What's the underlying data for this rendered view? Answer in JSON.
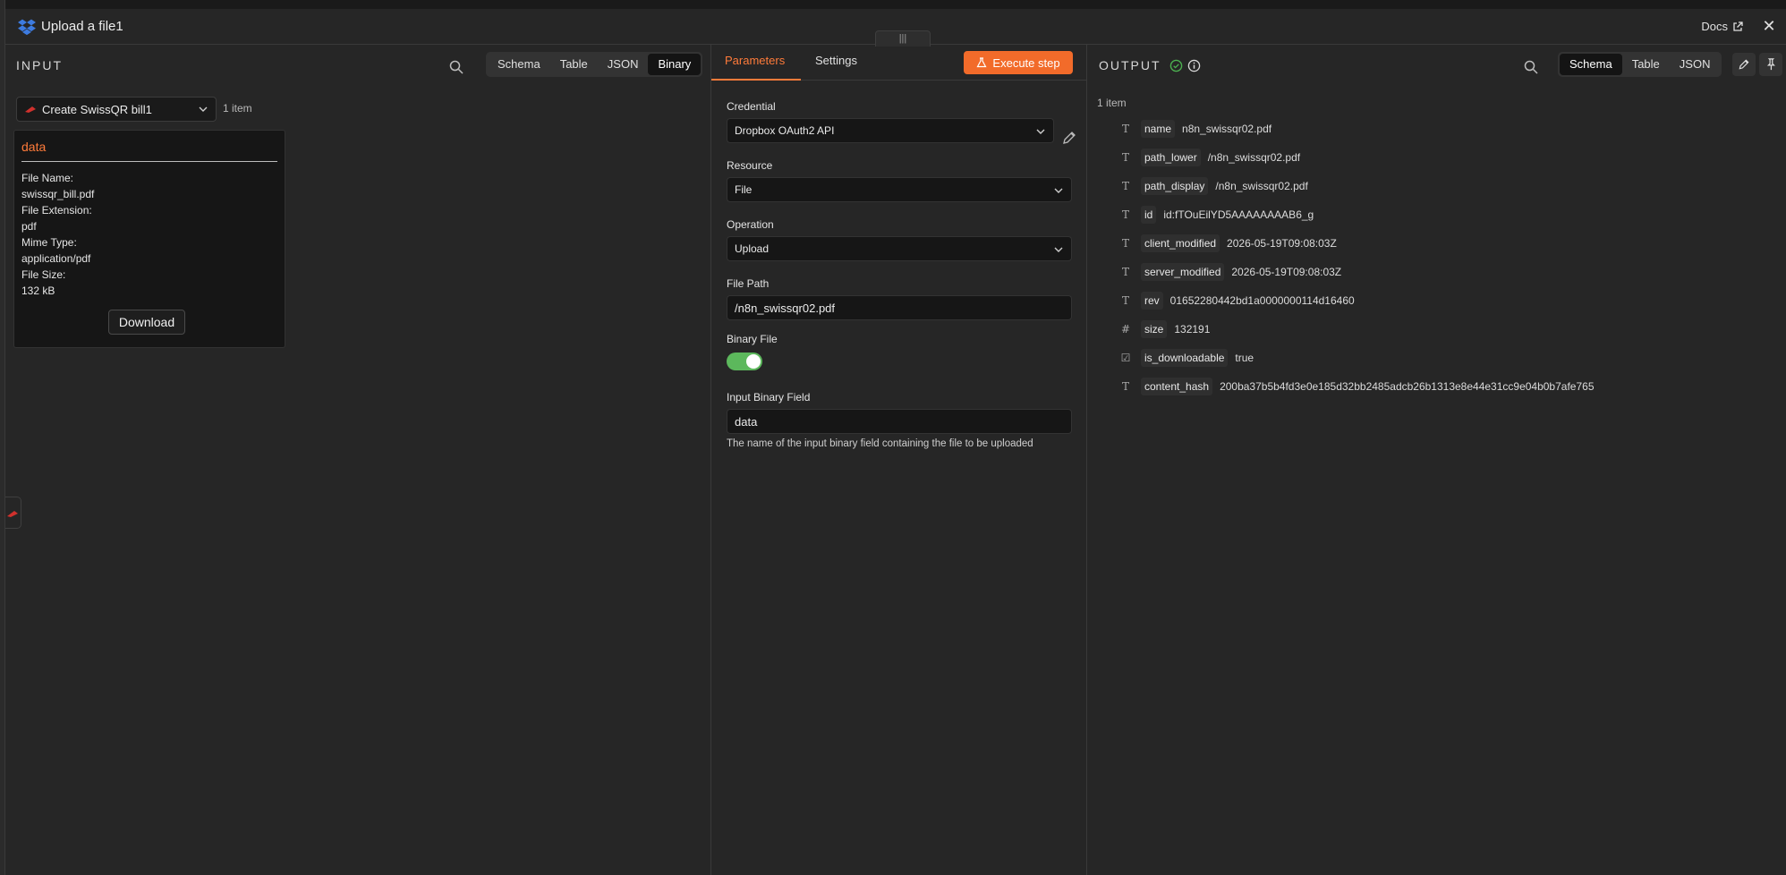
{
  "window": {
    "title": "Upload a file1",
    "docs_label": "Docs",
    "close_glyph": "✕",
    "handle_glyph": "|||"
  },
  "colors": {
    "accent": "#ff7b3a",
    "execute_bg": "#f26b2a",
    "toggle_on": "#5cb85c",
    "success": "#4caf50",
    "dropbox_blue": "#3d7be0"
  },
  "input": {
    "label": "INPUT",
    "tabs": [
      "Schema",
      "Table",
      "JSON",
      "Binary"
    ],
    "active_tab": "Binary",
    "node_select": "Create SwissQR bill1",
    "items_count": "1 item",
    "card": {
      "title": "data",
      "lines": [
        "File Name:",
        "swissqr_bill.pdf",
        "File Extension:",
        "pdf",
        "Mime Type:",
        "application/pdf",
        "File Size:",
        "132 kB"
      ],
      "download_label": "Download"
    }
  },
  "params": {
    "tabs": [
      "Parameters",
      "Settings"
    ],
    "active_tab": "Parameters",
    "execute_label": "Execute step",
    "credential": {
      "label": "Credential",
      "value": "Dropbox OAuth2 API"
    },
    "resource": {
      "label": "Resource",
      "value": "File"
    },
    "operation": {
      "label": "Operation",
      "value": "Upload"
    },
    "file_path": {
      "label": "File Path",
      "value": "/n8n_swissqr02.pdf"
    },
    "binary_file": {
      "label": "Binary File",
      "enabled": true
    },
    "input_binary_field": {
      "label": "Input Binary Field",
      "value": "data",
      "hint": "The name of the input binary field containing the file to be uploaded"
    }
  },
  "output": {
    "label": "OUTPUT",
    "tabs": [
      "Schema",
      "Table",
      "JSON"
    ],
    "active_tab": "Schema",
    "items_count": "1 item",
    "rows": [
      {
        "type": "T",
        "key": "name",
        "value": "n8n_swissqr02.pdf"
      },
      {
        "type": "T",
        "key": "path_lower",
        "value": "/n8n_swissqr02.pdf"
      },
      {
        "type": "T",
        "key": "path_display",
        "value": "/n8n_swissqr02.pdf"
      },
      {
        "type": "T",
        "key": "id",
        "value": "id:fTOuEilYD5AAAAAAAAB6_g"
      },
      {
        "type": "T",
        "key": "client_modified",
        "value": "2026-05-19T09:08:03Z"
      },
      {
        "type": "T",
        "key": "server_modified",
        "value": "2026-05-19T09:08:03Z"
      },
      {
        "type": "T",
        "key": "rev",
        "value": "01652280442bd1a0000000114d16460"
      },
      {
        "type": "#",
        "key": "size",
        "value": "132191"
      },
      {
        "type": "☑",
        "key": "is_downloadable",
        "value": "true"
      },
      {
        "type": "T",
        "key": "content_hash",
        "value": "200ba37b5b4fd3e0e185d32bb2485adcb26b1313e8e44e31cc9e04b0b7afe765"
      }
    ]
  }
}
